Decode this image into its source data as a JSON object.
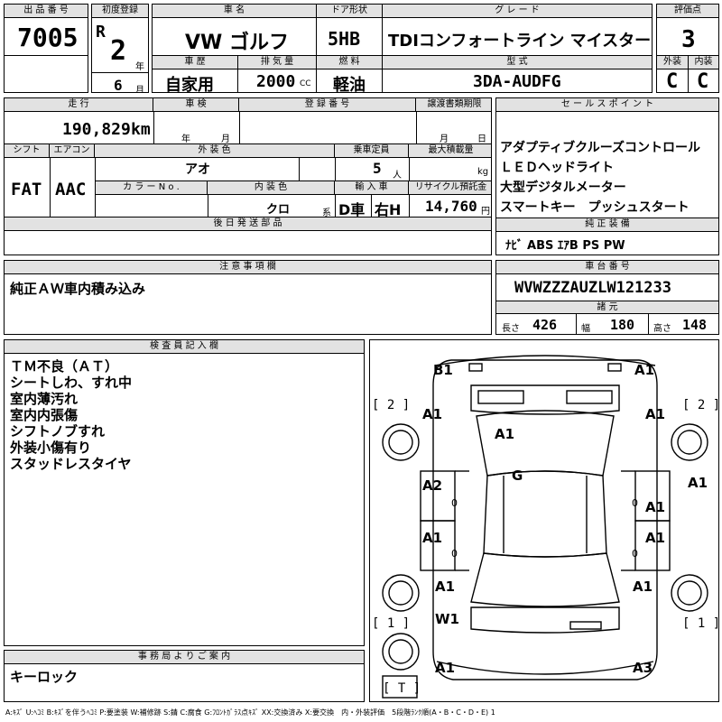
{
  "header": {
    "lot_label": "出 品 番 号",
    "lot_no": "7005",
    "first_reg_label": "初度登録",
    "era": "R",
    "reg_year": "2",
    "year_unit": "年",
    "reg_month": "6",
    "month_unit": "月",
    "car_name_label": "車 名",
    "car_name": "VW ゴルフ",
    "door_label": "ドア形状",
    "door": "5HB",
    "grade_label": "グ レ ー ド",
    "grade": "TDIコンフォートライン マイスター",
    "score_label": "評価点",
    "score": "3",
    "history_label": "車 歴",
    "history": "自家用",
    "displacement_label": "排 気 量",
    "displacement": "2000",
    "cc_unit": "CC",
    "fuel_label": "燃 料",
    "fuel": "軽油",
    "model_label": "型 式",
    "model": "3DA-AUDFG",
    "exterior_label": "外装",
    "exterior": "C",
    "interior_label": "内装",
    "interior": "C"
  },
  "spec": {
    "mileage_label": "走 行",
    "mileage": "190,829",
    "mileage_unit": "km",
    "inspection_label": "車 検",
    "insp_year_unit": "年",
    "insp_month_unit": "月",
    "plate_label": "登 録 番 号",
    "transfer_label": "譲渡書類期限",
    "transfer_month_unit": "月",
    "transfer_day_unit": "日",
    "shift_label": "シフト",
    "shift": "FAT",
    "ac_label": "エアコン",
    "ac": "AAC",
    "ext_color_label": "外 装 色",
    "ext_color": "アオ",
    "capacity_label": "乗車定員",
    "capacity": "5",
    "capacity_unit": "人",
    "max_load_label": "最大積載量",
    "max_load_unit": "kg",
    "color_no_label": "カ ラ ー N o .",
    "int_color_label": "内 装 色",
    "int_color": "クロ",
    "int_color_unit": "系",
    "import_label": "輸 入 車",
    "import_type": "D車",
    "steering": "右H",
    "recycle_label": "リサイクル預託金",
    "recycle": "14,760",
    "recycle_unit": "円",
    "later_parts_label": "後 日 発 送 部 品"
  },
  "sales": {
    "label": "セ ー ル ス ポ イ ン ト",
    "points": [
      "アダプティブクルーズコントロール",
      "ＬＥＤヘッドライト",
      "大型デジタルメーター",
      "スマートキー　プッシュスタート"
    ],
    "equip_label": "純 正 装 備",
    "equipment": "ﾅﾋﾞ ABS ｴｱB PS PW"
  },
  "caution": {
    "label": "注 意 事 項 欄",
    "text": "純正ＡＷ車内積み込み"
  },
  "chassis": {
    "label": "車 台 番 号",
    "vin": "WVWZZZAUZLW121233",
    "dims_label": "諸 元",
    "length_label": "長さ",
    "length": "426",
    "width_label": "幅",
    "width": "180",
    "height_label": "高さ",
    "height": "148"
  },
  "inspector": {
    "label": "検 査 員 記 入 欄",
    "notes": [
      "ＴＭ不良（ＡＴ）",
      "シートしわ、すれ中",
      "室内薄汚れ",
      "室内内張傷",
      "シフトノブすれ",
      "外装小傷有り",
      "スタッドレスタイヤ"
    ]
  },
  "office": {
    "label": "事 務 局 よ り ご 案 内",
    "text": "キーロック"
  },
  "diagram": {
    "tire_labels": [
      "[ 2 ]",
      "[ 2 ]",
      "[ 1 ]",
      "[ 1 ]",
      "[ T ]"
    ],
    "marks": [
      "B1",
      "A1",
      "A1",
      "A1",
      "A1",
      "G",
      "A2",
      "A1",
      "A1",
      "A1",
      "A1",
      "A1",
      "W1",
      "A1",
      "A1",
      "A3"
    ],
    "zero_marks": [
      "0",
      "0",
      "0",
      "0"
    ]
  },
  "legend": "A:ｷｽﾞ U:ﾍｺﾐ B:ｷｽﾞを伴うﾍｺﾐ P:要塗装 W:補修跡 S:錆 C:腐食 G:ﾌﾛﾝﾄｶﾞﾗｽ点ｷｽﾞ XX:交換済み X:要交換　内・外装評価　5段階ﾗﾝｸ順(A・B・C・D・E) 1"
}
